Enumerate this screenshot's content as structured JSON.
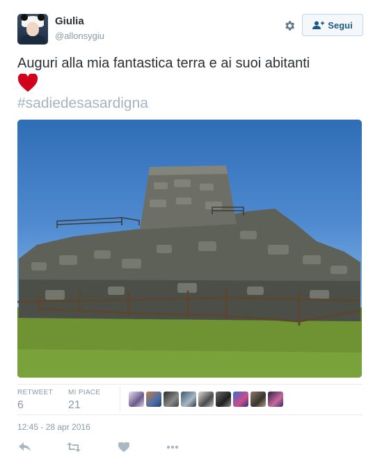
{
  "user": {
    "name": "Giulia",
    "handle": "@allonsygiu"
  },
  "follow_button": {
    "label": "Segui",
    "icon": "add-user-icon"
  },
  "settings_icon": "gear-icon",
  "tweet": {
    "text": "Auguri alla mia fantastica terra e ai suoi abitanti",
    "emoji": "red-heart",
    "hashtag": "#sadiedesasardigna",
    "photo_subject": "nuraghe-stone-tower"
  },
  "stats": {
    "retweet_label": "RETWEET",
    "retweet_count": "6",
    "likes_label": "MI PIACE",
    "likes_count": "21",
    "liker_avatars": 9
  },
  "timestamp": "12:45 - 28 apr 2016",
  "actions": [
    "reply-icon",
    "retweet-icon",
    "like-icon",
    "more-icon"
  ],
  "colors": {
    "text": "#292f33",
    "muted": "#8899a6",
    "hashtag": "#a3b5c4",
    "follow_text": "#1c5686",
    "heart": "#d0021b"
  }
}
